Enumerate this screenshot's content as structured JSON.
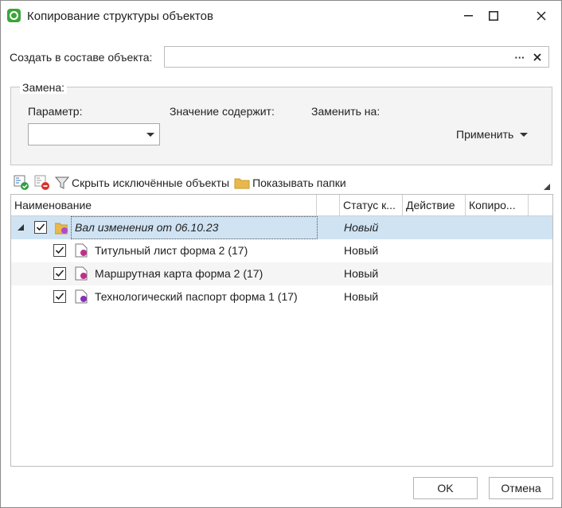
{
  "window": {
    "title": "Копирование структуры объектов"
  },
  "create_in": {
    "label": "Создать в составе объекта:",
    "value": "",
    "browse_label": "···"
  },
  "replace": {
    "group_title": "Замена:",
    "param_label": "Параметр:",
    "param_value": "",
    "contains_label": "Значение содержит:",
    "replace_with_label": "Заменить на:",
    "apply_label": "Применить"
  },
  "toolbar": {
    "hide_excluded_label": "Скрыть исключённые объекты",
    "show_folders_label": "Показывать папки"
  },
  "grid": {
    "columns": [
      "Наименование",
      "Статус к...",
      "Действие",
      "Копиро..."
    ],
    "rows": [
      {
        "name": "Вал изменения от 06.10.23",
        "status": "Новый",
        "checked": true,
        "level": 0
      },
      {
        "name": "Титульный лист форма 2 (17)",
        "status": "Новый",
        "checked": true,
        "level": 1
      },
      {
        "name": "Маршрутная карта форма 2 (17)",
        "status": "Новый",
        "checked": true,
        "level": 1
      },
      {
        "name": "Технологический паспорт форма 1 (17)",
        "status": "Новый",
        "checked": true,
        "level": 1
      }
    ]
  },
  "footer": {
    "ok_label": "OK",
    "cancel_label": "Отмена"
  },
  "colors": {
    "selection": "#cfe3f3",
    "app_icon": "#3aa63a",
    "folder": "#e8b84a"
  }
}
